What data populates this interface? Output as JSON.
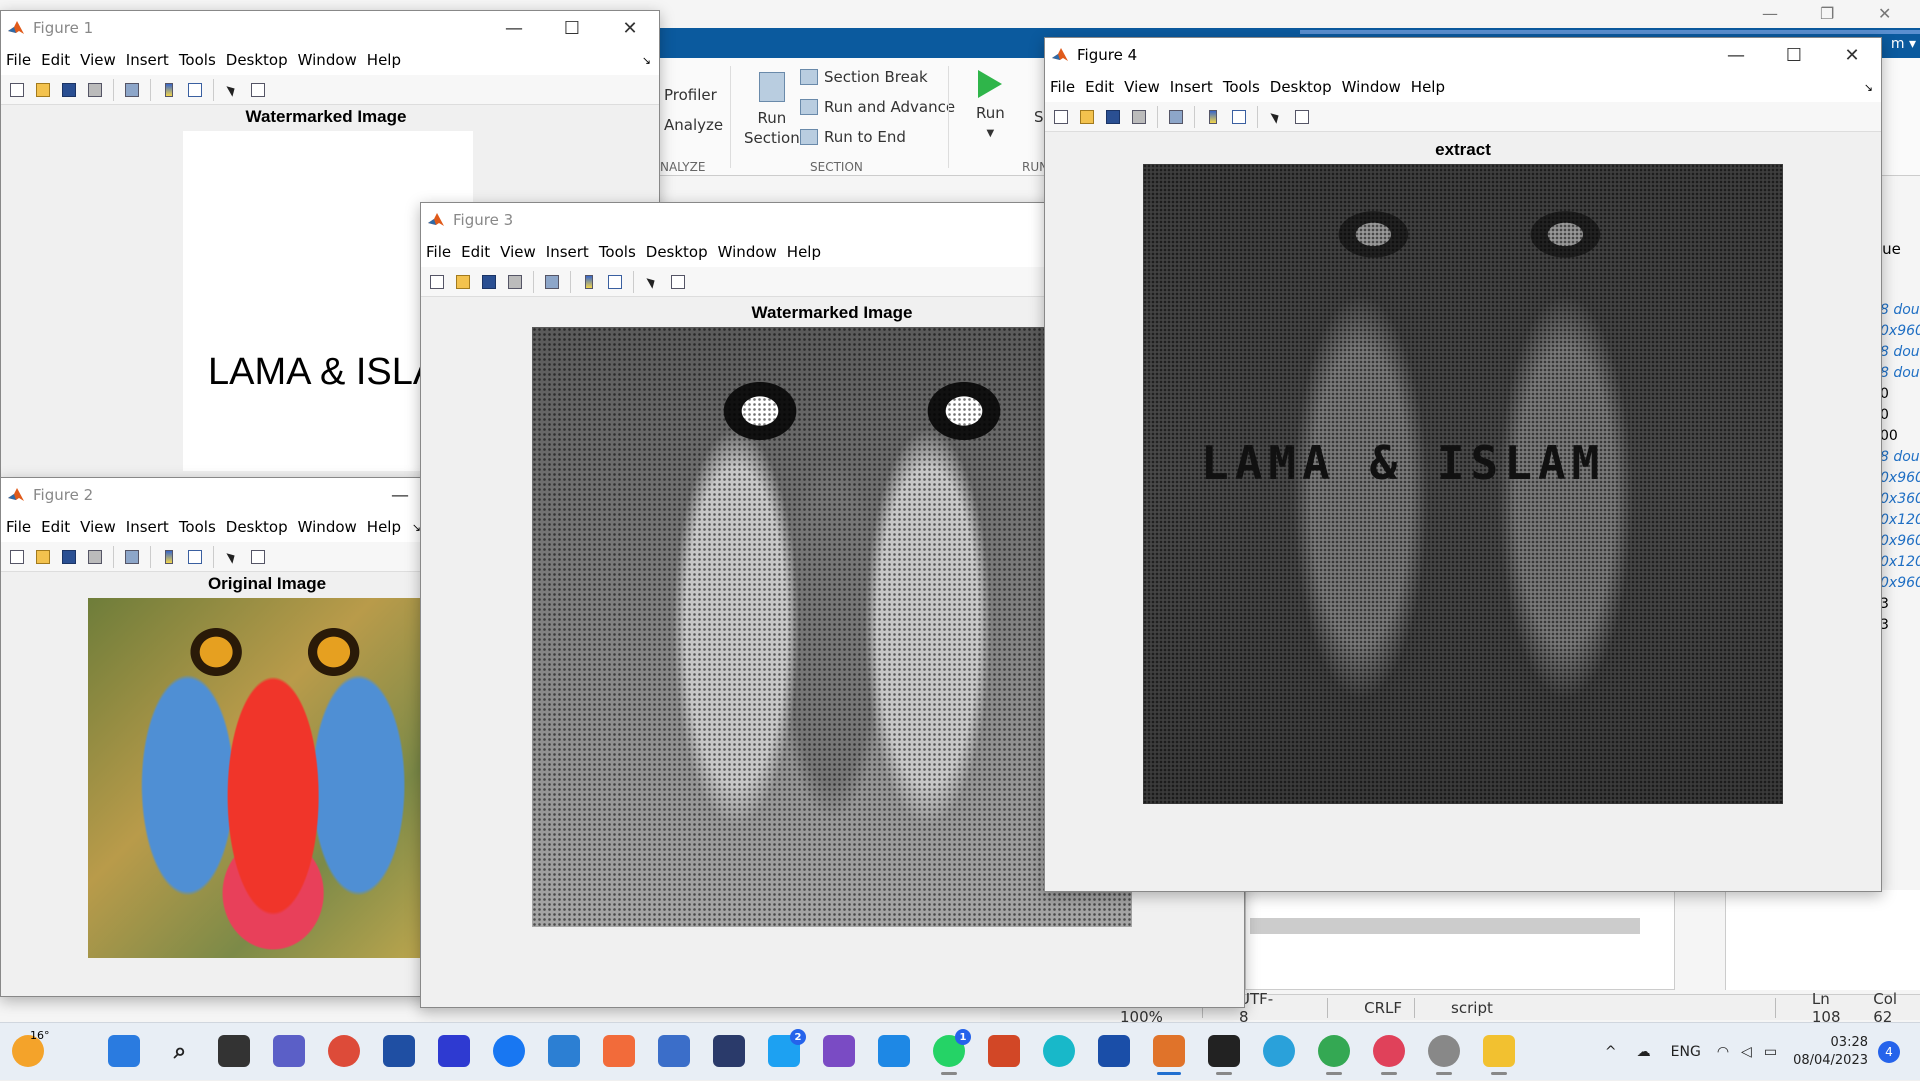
{
  "matlab": {
    "user_label": "m",
    "ribbon": {
      "profiler_label": "Profiler",
      "analyze_label": "Analyze",
      "analyze_caption": "NALYZE",
      "run_section_label": "Run\nSection",
      "section_break_label": "Section Break",
      "run_and_advance_label": "Run and Advance",
      "run_to_end_label": "Run to End",
      "section_caption": "SECTION",
      "run_label": "Run",
      "run_caption": "RUN",
      "s_partial": "S"
    },
    "workspace": {
      "value_header": "lue",
      "values": [
        "8 dou",
        "0x960",
        "8 dou",
        "8 dou",
        "0",
        "0",
        "00",
        "8 dou",
        "0x960",
        "0x360",
        "0x120",
        "0x960",
        "0x120",
        "0x960",
        "3",
        "3"
      ]
    },
    "statusbar": {
      "zoom": "Zoom: 100%",
      "encoding": "UTF-8",
      "line_ending": "CRLF",
      "file_type": "script",
      "line": "Ln  108",
      "col": "Col  62"
    }
  },
  "menu": [
    "File",
    "Edit",
    "View",
    "Insert",
    "Tools",
    "Desktop",
    "Window",
    "Help"
  ],
  "figures": {
    "fig1": {
      "title": "Figure 1",
      "axes_title": "Watermarked Image",
      "text": "LAMA & ISLA"
    },
    "fig2": {
      "title": "Figure 2",
      "axes_title": "Original Image"
    },
    "fig3": {
      "title": "Figure 3",
      "axes_title": "Watermarked Image"
    },
    "fig4": {
      "title": "Figure 4",
      "axes_title": "extract",
      "text": "LAMA & ISLAM"
    }
  },
  "taskbar": {
    "weather": "16°",
    "badges": {
      "twitter": "2",
      "whatsapp": "1"
    },
    "tray": {
      "lang": "ENG",
      "time": "03:28",
      "date": "08/04/2023",
      "notifications": "4"
    }
  },
  "colors": {
    "matlab_blue": "#0b5a9e",
    "taskbar_bg": "#e8eef5",
    "accent": "#2563eb"
  }
}
